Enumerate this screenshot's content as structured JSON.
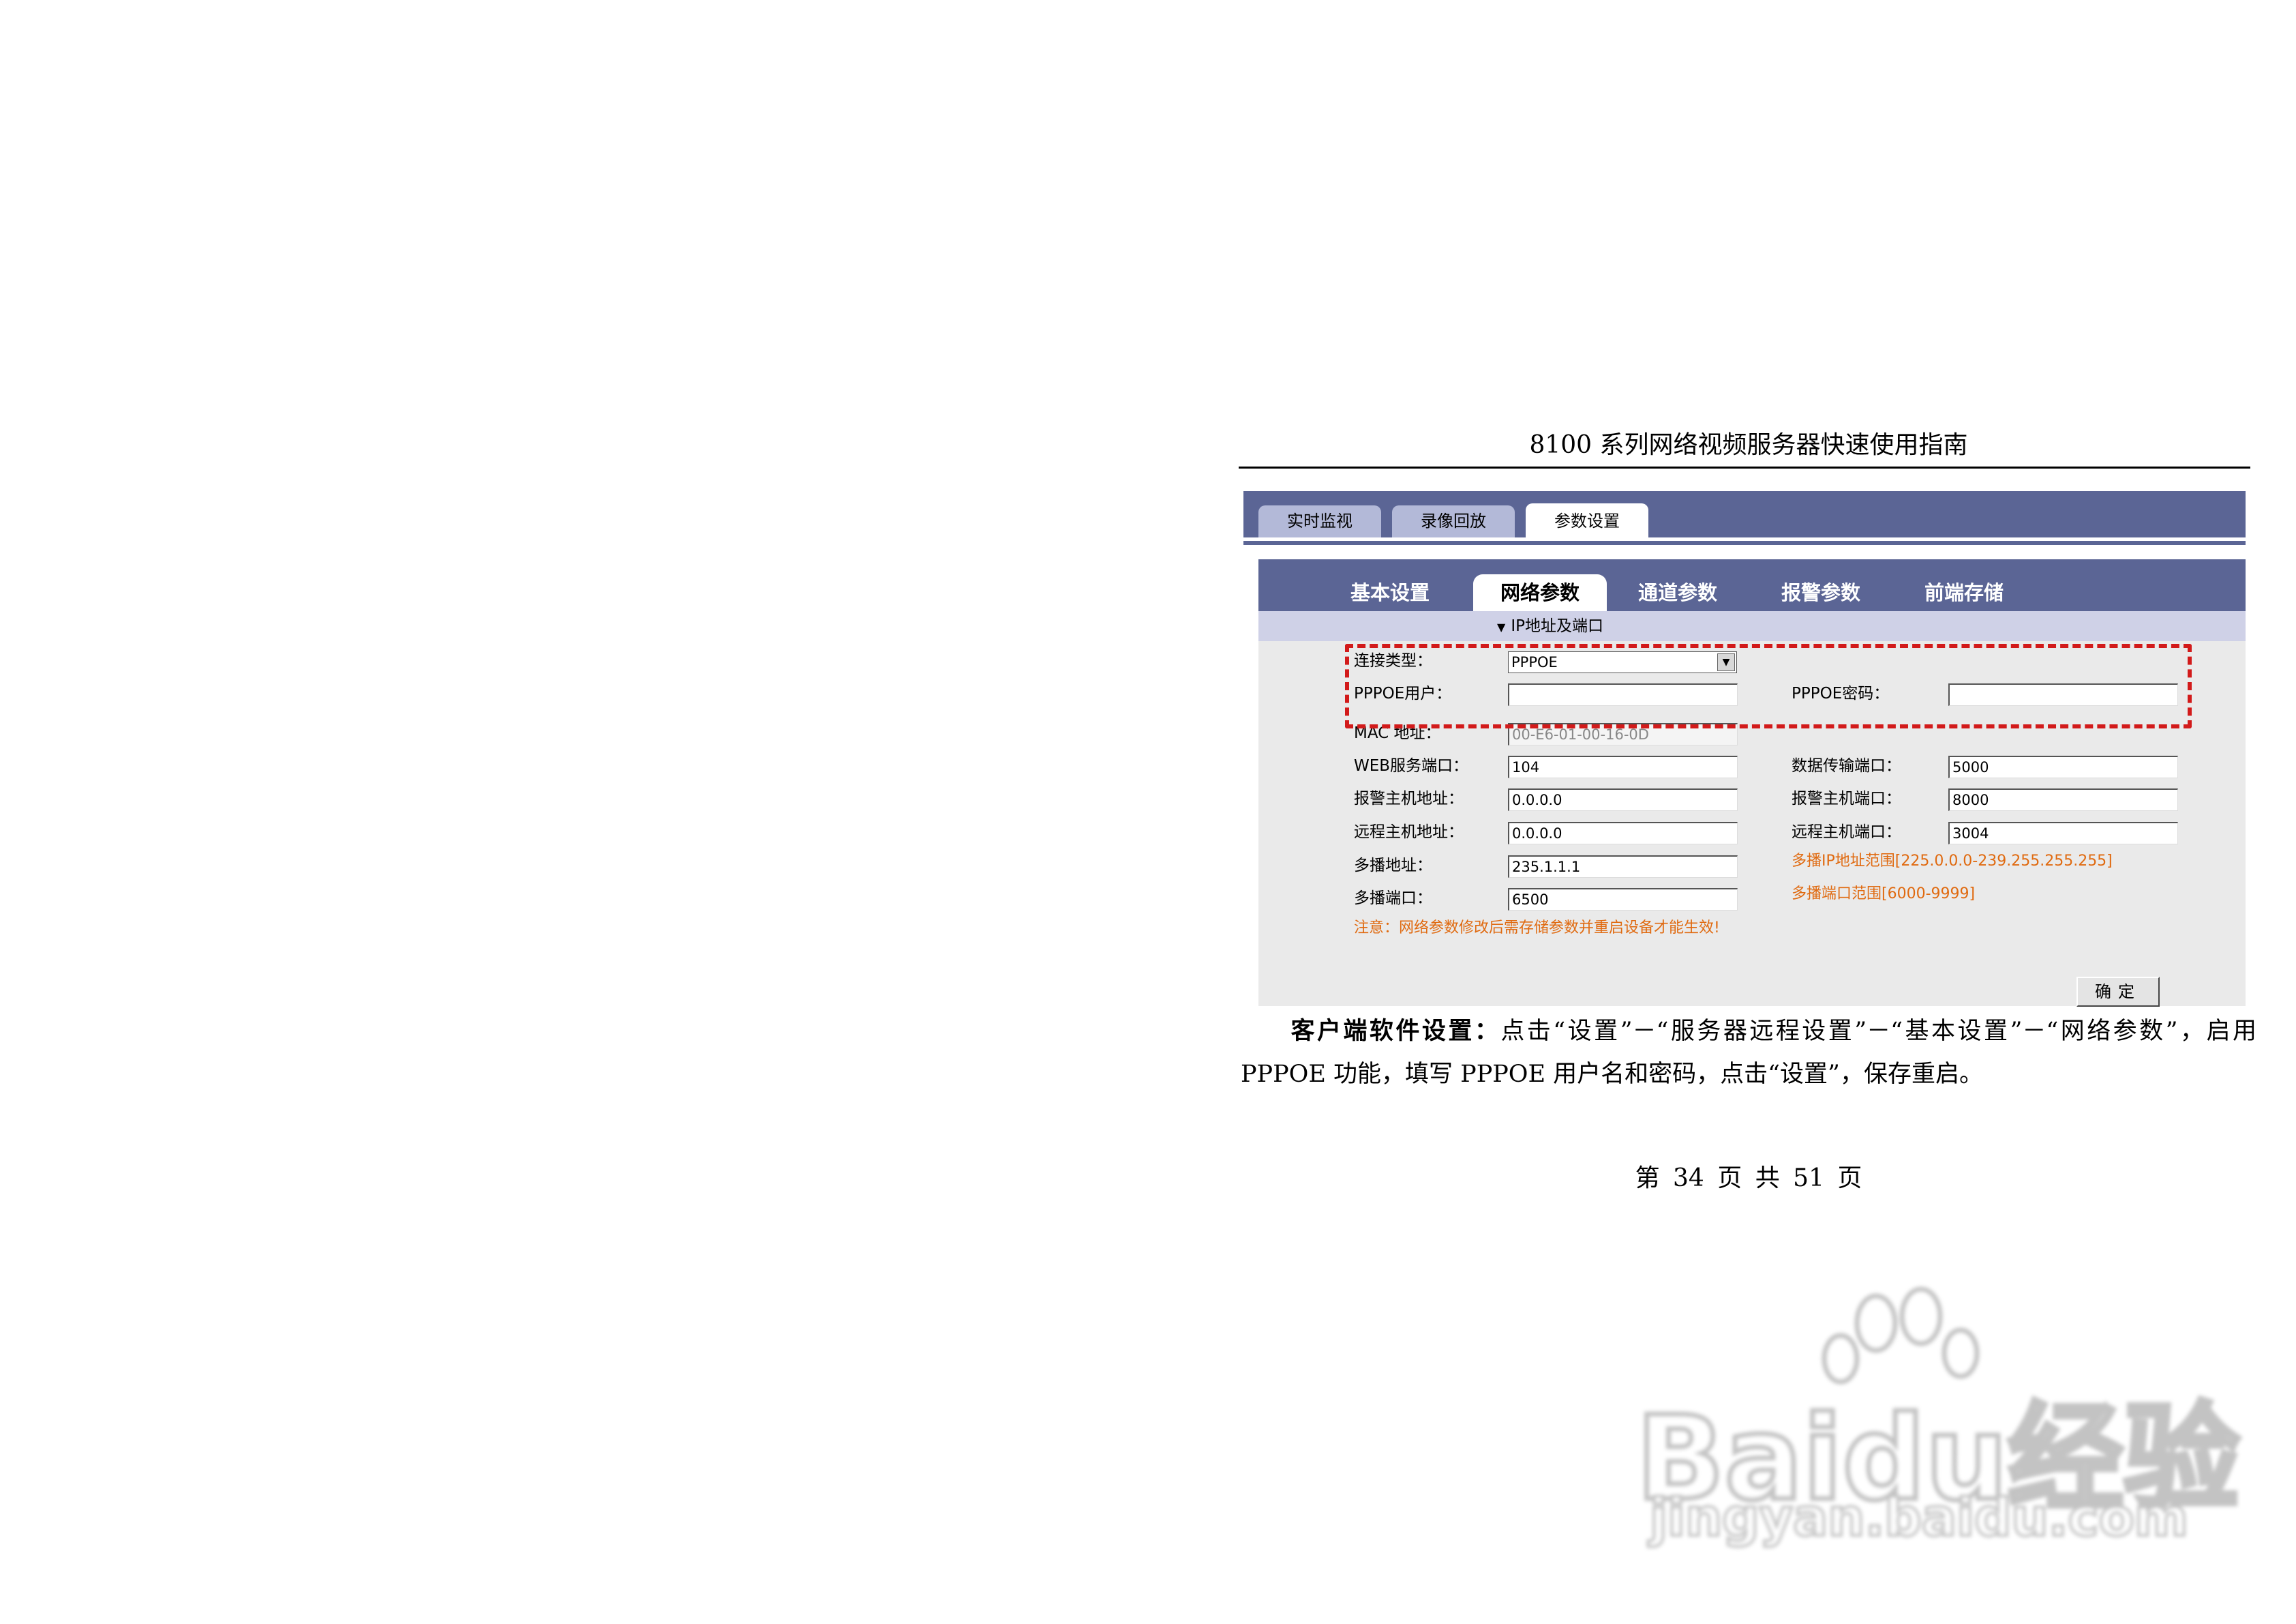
{
  "document": {
    "title": "8100 系列网络视频服务器快速使用指南",
    "page_number": "第 34 页 共 51 页"
  },
  "top_tabs": [
    {
      "label": "实时监视",
      "active": false
    },
    {
      "label": "录像回放",
      "active": false
    },
    {
      "label": "参数设置",
      "active": true
    }
  ],
  "sub_tabs": [
    {
      "label": "基本设置",
      "active": false
    },
    {
      "label": "网络参数",
      "active": true
    },
    {
      "label": "通道参数",
      "active": false
    },
    {
      "label": "报警参数",
      "active": false
    },
    {
      "label": "前端存储",
      "active": false
    }
  ],
  "section": {
    "label": "IP地址及端口"
  },
  "form": {
    "connection_type": {
      "label": "连接类型：",
      "value": "PPPOE"
    },
    "pppoe_user": {
      "label": "PPPOE用户：",
      "value": ""
    },
    "pppoe_password": {
      "label": "PPPOE密码：",
      "value": ""
    },
    "mac_address": {
      "label": "MAC 地址：",
      "value": "00-E6-01-00-16-0D"
    },
    "web_port": {
      "label": "WEB服务端口：",
      "value": "104"
    },
    "data_port": {
      "label": "数据传输端口：",
      "value": "5000"
    },
    "alarm_host_address": {
      "label": "报警主机地址：",
      "value": "0.0.0.0"
    },
    "alarm_host_port": {
      "label": "报警主机端口：",
      "value": "8000"
    },
    "remote_host_address": {
      "label": "远程主机地址：",
      "value": "0.0.0.0"
    },
    "remote_host_port": {
      "label": "远程主机端口：",
      "value": "3004"
    },
    "multicast_address": {
      "label": "多播地址：",
      "value": "235.1.1.1"
    },
    "multicast_ip_range_hint": "多播IP地址范围[225.0.0.0-239.255.255.255]",
    "multicast_port": {
      "label": "多播端口：",
      "value": "6500"
    },
    "multicast_port_range_hint": "多播端口范围[6000-9999]",
    "notice": "注意：网络参数修改后需存储参数并重启设备才能生效!",
    "ok_label": "确定"
  },
  "body": {
    "bold_lead": "客户端软件设置：",
    "text": "点击“设置”－“服务器远程设置”－“基本设置”－“网络参数”，启用 PPPOE 功能，填写 PPPOE 用户名和密码，点击“设置”，保存重启。"
  },
  "watermark": {
    "brand": "Baidu经验",
    "url": "jingyan.baidu.com"
  },
  "colors": {
    "tab_bar": "#5b6595",
    "section_bar": "#cfd1e7",
    "form_bg": "#eaeaea",
    "hint": "#e06a10",
    "highlight_dash": "#d21a1a"
  }
}
